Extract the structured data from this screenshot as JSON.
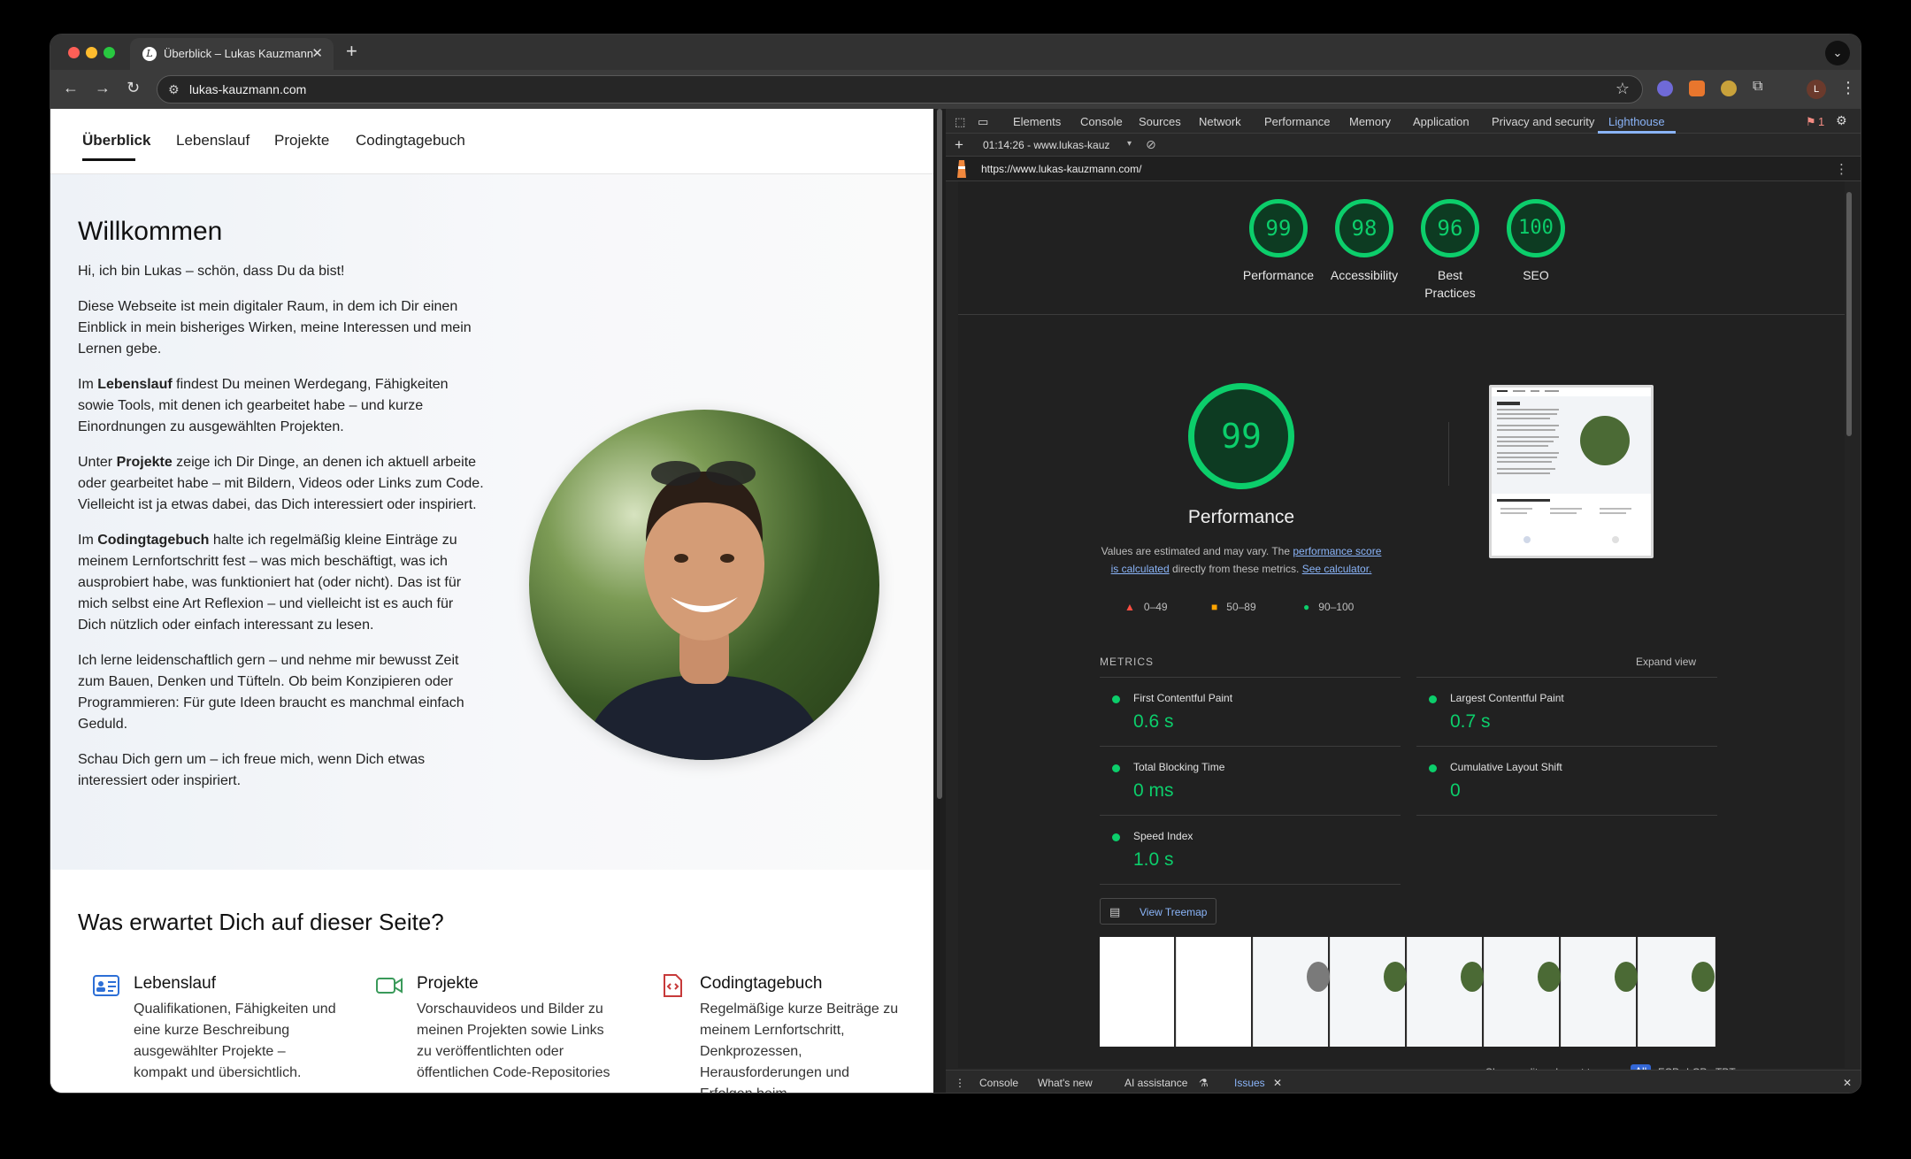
{
  "browser": {
    "tab_title": "Überblick – Lukas Kauzmann",
    "tab_favicon": "L",
    "url": "lukas-kauzmann.com",
    "profile_initial": "L"
  },
  "site": {
    "nav": [
      "Überblick",
      "Lebenslauf",
      "Projekte",
      "Codingtagebuch"
    ],
    "title": "Willkommen",
    "greeting": "Hi, ich bin Lukas – schön, dass Du da bist!",
    "p1": "Diese Webseite ist mein digitaler Raum, in dem ich Dir einen Einblick in mein bisheriges Wirken, meine Interessen und mein Lernen gebe.",
    "p2_pre": "Im ",
    "p2_bold": "Lebenslauf",
    "p2_post": " findest Du meinen Werdegang, Fähigkeiten sowie Tools, mit denen ich gearbeitet habe – und kurze Einordnungen zu ausgewählten Projekten.",
    "p3_pre": "Unter ",
    "p3_bold": "Projekte",
    "p3_post": " zeige ich Dir Dinge, an denen ich aktuell arbeite oder gearbeitet habe – mit Bildern, Videos oder Links zum Code. Vielleicht ist ja etwas dabei, das Dich interessiert oder inspiriert.",
    "p4_pre": "Im ",
    "p4_bold": "Codingtagebuch",
    "p4_post": " halte ich regelmäßig kleine Einträge zu meinem Lernfortschritt fest – was mich beschäftigt, was ich ausprobiert habe, was funktioniert hat (oder nicht). Das ist für mich selbst eine Art Reflexion – und vielleicht ist es auch für Dich nützlich oder einfach interessant zu lesen.",
    "p5": "Ich lerne leidenschaftlich gern – und nehme mir bewusst Zeit zum Bauen, Denken und Tüfteln. Ob beim Konzipieren oder Programmieren: Für gute Ideen braucht es manchmal einfach Geduld.",
    "p6": "Schau Dich gern um – ich freue mich, wenn Dich etwas interessiert oder inspiriert.",
    "features_title": "Was erwartet Dich auf dieser Seite?",
    "features": [
      {
        "title": "Lebenslauf",
        "body": "Qualifikationen, Fähigkeiten und eine kurze Beschreibung ausgewählter Projekte – kompakt und übersichtlich.",
        "icon": "id-card-icon"
      },
      {
        "title": "Projekte",
        "body": "Vorschauvideos und Bilder zu meinen Projekten sowie Links zu veröffentlichten oder öffentlichen Code-Repositories",
        "icon": "video-camera-icon"
      },
      {
        "title": "Codingtagebuch",
        "body": "Regelmäßige kurze Beiträge zu meinem Lernfortschritt, Denkprozessen, Herausforderungen und Erfolgen beim",
        "icon": "code-file-icon"
      }
    ]
  },
  "devtools": {
    "tabs": [
      "Elements",
      "Console",
      "Sources",
      "Network",
      "Performance",
      "Memory",
      "Application",
      "Privacy and security",
      "Lighthouse"
    ],
    "issues_count": "1",
    "report_selector": "01:14:26 - www.lukas-kauz",
    "report_url": "https://www.lukas-kauzmann.com/",
    "scores": [
      {
        "value": 99,
        "label": "Performance"
      },
      {
        "value": 98,
        "label": "Accessibility"
      },
      {
        "value": 96,
        "label": "Best Practices"
      },
      {
        "value": 100,
        "label": "SEO"
      }
    ],
    "perf_score": 99,
    "perf_title": "Performance",
    "perf_note_1": "Values are estimated and may vary. The ",
    "perf_note_link1": "performance score is calculated",
    "perf_note_2": " directly from these metrics. ",
    "perf_note_link2": "See calculator.",
    "legend": [
      "0–49",
      "50–89",
      "90–100"
    ],
    "metrics_header": "METRICS",
    "expand_view": "Expand view",
    "metrics": [
      {
        "name": "First Contentful Paint",
        "value": "0.6 s"
      },
      {
        "name": "Largest Contentful Paint",
        "value": "0.7 s"
      },
      {
        "name": "Total Blocking Time",
        "value": "0 ms"
      },
      {
        "name": "Cumulative Layout Shift",
        "value": "0"
      },
      {
        "name": "Speed Index",
        "value": "1.0 s"
      }
    ],
    "view_treemap": "View Treemap",
    "audits_label": "Show audits relevant to:",
    "audit_filters": [
      "All",
      "FCP",
      "LCP",
      "TBT"
    ],
    "drawer_tabs": [
      "Console",
      "What's new",
      "AI assistance",
      "Issues"
    ],
    "colors": {
      "pass": "#0cce6b",
      "average": "#ffa400",
      "fail": "#ff4e42",
      "link": "#8ab4f8"
    }
  }
}
